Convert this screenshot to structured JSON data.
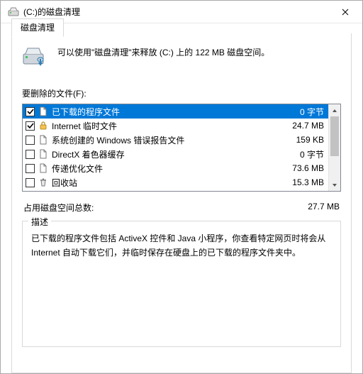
{
  "window": {
    "title": "(C:)的磁盘清理"
  },
  "tab": {
    "label": "磁盘清理"
  },
  "intro": "可以使用\"磁盘清理\"来释放  (C:) 上的 122 MB 磁盘空间。",
  "files_label": "要删除的文件(F):",
  "items": [
    {
      "checked": true,
      "icon": "file",
      "name": "已下载的程序文件",
      "size": "0 字节",
      "selected": true
    },
    {
      "checked": true,
      "icon": "lock",
      "name": "Internet 临时文件",
      "size": "24.7 MB",
      "selected": false
    },
    {
      "checked": false,
      "icon": "file",
      "name": "系统创建的 Windows 错误报告文件",
      "size": "159 KB",
      "selected": false
    },
    {
      "checked": false,
      "icon": "file",
      "name": "DirectX 着色器缓存",
      "size": "0 字节",
      "selected": false
    },
    {
      "checked": false,
      "icon": "file",
      "name": "传递优化文件",
      "size": "73.6 MB",
      "selected": false
    },
    {
      "checked": false,
      "icon": "recycle",
      "name": "回收站",
      "size": "15.3 MB",
      "selected": false
    }
  ],
  "total_label": "占用磁盘空间总数:",
  "total_value": "27.7 MB",
  "group_title": "描述",
  "description": "已下载的程序文件包括 ActiveX 控件和 Java 小程序，你查看特定网页时将会从 Internet 自动下载它们，并临时保存在硬盘上的已下载的程序文件夹中。"
}
